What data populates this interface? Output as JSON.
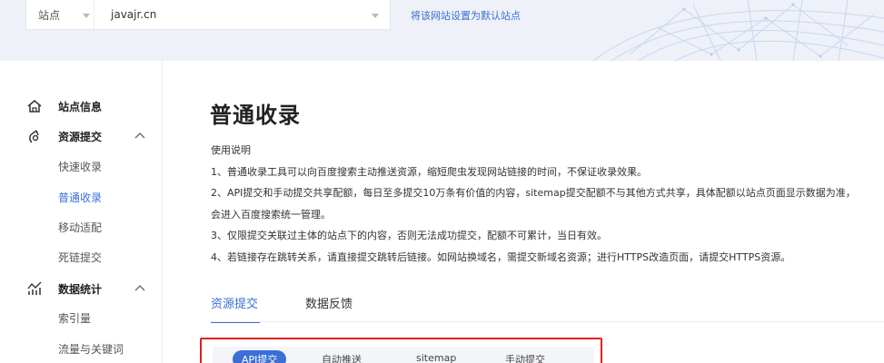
{
  "topbar": {
    "site_label": "站点",
    "site_value": "javajr.cn",
    "set_default_link": "将该网站设置为默认站点"
  },
  "sidebar": {
    "groups": [
      {
        "label": "站点信息",
        "icon": "home-icon"
      },
      {
        "label": "资源提交",
        "icon": "submit-icon",
        "expanded": true,
        "items": [
          "快速收录",
          "普通收录",
          "移动适配",
          "死链提交"
        ]
      },
      {
        "label": "数据统计",
        "icon": "stats-icon",
        "expanded": true,
        "items": [
          "索引量",
          "流量与关键词"
        ]
      }
    ],
    "active_item": "普通收录"
  },
  "main": {
    "title": "普通收录",
    "usage_title": "使用说明",
    "usage_lines": [
      "1、普通收录工具可以向百度搜索主动推送资源，缩短爬虫发现网站链接的时间，不保证收录效果。",
      "2、API提交和手动提交共享配额，每日至多提交10万条有价值的内容，sitemap提交配额不与其他方式共享，具体配额以站点页面显示数据为准，",
      "会进入百度搜索统一管理。",
      "3、仅限提交关联过主体的站点下的内容，否则无法成功提交，配额不可累计，当日有效。",
      "4、若链接存在跳转关系，请直接提交跳转后链接。如网站换域名，需提交新域名资源；进行HTTPS改造页面，请提交HTTPS资源。"
    ],
    "tabs": [
      {
        "label": "资源提交",
        "active": true
      },
      {
        "label": "数据反馈",
        "active": false
      }
    ],
    "subtabs": [
      "API提交",
      "自动推送",
      "sitemap",
      "手动提交"
    ]
  },
  "colors": {
    "accent": "#3b6fd6",
    "highlight_border": "#e02020",
    "topbar_bg": "#eef1f8"
  }
}
